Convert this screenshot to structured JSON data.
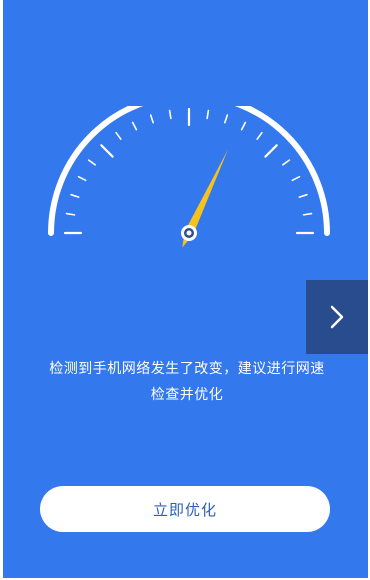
{
  "gauge": {
    "needle_angle_deg": 25,
    "ticks": 21,
    "arc_color": "#ffffff",
    "needle_color": "#f6c21c"
  },
  "next_button": {
    "icon": "chevron-right-icon"
  },
  "message": {
    "line1": "检测到手机网络发生了改变，建议进行网速",
    "line2": "检查并优化"
  },
  "action_button": {
    "label": "立即优化"
  },
  "colors": {
    "background": "#3478ee",
    "side_tab": "#294c8f",
    "button_text": "#2d5fb7"
  }
}
